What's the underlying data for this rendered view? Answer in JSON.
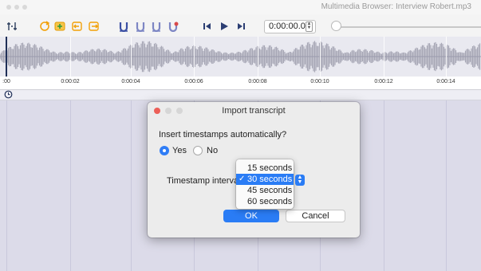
{
  "window": {
    "title": "Multimedia Browser: Interview Robert.mp3"
  },
  "toolbar": {
    "buttons": [
      {
        "name": "add-marker-icon",
        "color": "#2b3d5c"
      },
      {
        "name": "refresh-icon",
        "color": "#f2a007"
      },
      {
        "name": "insert-icon",
        "color": "#f2a007"
      },
      {
        "name": "link-in-icon",
        "color": "#f2a007"
      },
      {
        "name": "link-out-icon",
        "color": "#f2a007"
      },
      {
        "name": "set-marker-icon",
        "color": "#3b4fa3"
      },
      {
        "name": "marker-2-icon",
        "color": "#3b4fa3"
      },
      {
        "name": "marker-3-icon",
        "color": "#3b4fa3"
      },
      {
        "name": "marker-4-icon",
        "color": "#3b4fa3"
      },
      {
        "name": "skip-back-icon",
        "color": "#2c3e73"
      },
      {
        "name": "play-icon",
        "color": "#2c3e73"
      },
      {
        "name": "skip-forward-icon",
        "color": "#2c3e73"
      }
    ],
    "time": "0:00:00.0"
  },
  "timeline": {
    "labels": [
      ":00",
      "0:00:02",
      "0:00:04",
      "0:00:06",
      "0:00:08",
      "0:00:10",
      "0:00:12",
      "0:00:14"
    ]
  },
  "dialog": {
    "title": "Import transcript",
    "question": "Insert timestamps automatically?",
    "yes_label": "Yes",
    "no_label": "No",
    "selected": "Yes",
    "interval_label": "Timestamp interval",
    "options": [
      "15 seconds",
      "30 seconds",
      "45 seconds",
      "60 seconds"
    ],
    "selected_option": "30 seconds",
    "ok_label": "OK",
    "cancel_label": "Cancel"
  },
  "colors": {
    "accent": "#2a7cf5",
    "waveform": "#a8a8b6",
    "track_bg": "#dcdbe9"
  }
}
